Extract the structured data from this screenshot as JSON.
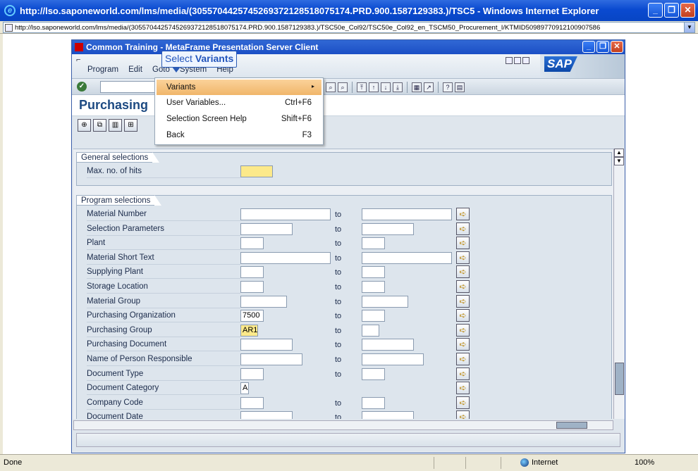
{
  "browser": {
    "title": "http://lso.saponeworld.com/lms/media/(30557044257452693721285180751​74.PRD.900.1587129383.)/TSC5 - Windows Internet Explorer",
    "address": "http://lso.saponeworld.com/lms/media/(305570442574526937212851807517​4.PRD.900.1587129383.)/TSC50e_Col92/TSC50e_Col92_en_TSCM50_Procurement_I/KTMID50989770912100907586",
    "status": "Done",
    "zone": "Internet",
    "zoom": "100%"
  },
  "sap_window": {
    "title": "Common Training - MetaFrame Presentation Server Client",
    "menus": [
      "Program",
      "Edit",
      "Goto",
      "System",
      "Help"
    ],
    "logo": "SAP",
    "screen_title": "Purchasing"
  },
  "tooltip": {
    "prefix": "Select ",
    "emphasis": "Variants"
  },
  "dropdown": {
    "items": [
      {
        "label": "Variants",
        "shortcut": "",
        "submenu": true,
        "active": true
      },
      {
        "label": "User Variables...",
        "shortcut": "Ctrl+F6"
      },
      {
        "label": "Selection Screen Help",
        "shortcut": "Shift+F6"
      },
      {
        "label": "Back",
        "shortcut": "F3"
      }
    ]
  },
  "general_selections": {
    "header": "General selections",
    "max_hits_label": "Max. no. of hits",
    "max_hits_value": ""
  },
  "program_selections": {
    "header": "Program selections",
    "to_label": "to",
    "rows": [
      {
        "label": "Material Number",
        "from": "",
        "to": ""
      },
      {
        "label": "Selection Parameters",
        "from": "",
        "to": ""
      },
      {
        "label": "Plant",
        "from": "",
        "to": ""
      },
      {
        "label": "Material Short Text",
        "from": "",
        "to": ""
      },
      {
        "label": "Supplying Plant",
        "from": "",
        "to": ""
      },
      {
        "label": "Storage Location",
        "from": "",
        "to": ""
      },
      {
        "label": "Material Group",
        "from": "",
        "to": ""
      },
      {
        "label": "Purchasing Organization",
        "from": "7500",
        "to": ""
      },
      {
        "label": "Purchasing Group",
        "from": "AR1",
        "to": ""
      },
      {
        "label": "Purchasing Document",
        "from": "",
        "to": ""
      },
      {
        "label": "Name of Person Responsible",
        "from": "",
        "to": ""
      },
      {
        "label": "Document Type",
        "from": "",
        "to": ""
      },
      {
        "label": "Document Category",
        "from": "A",
        "to": null
      },
      {
        "label": "Company Code",
        "from": "",
        "to": ""
      },
      {
        "label": "Document Date",
        "from": "",
        "to": ""
      }
    ]
  }
}
